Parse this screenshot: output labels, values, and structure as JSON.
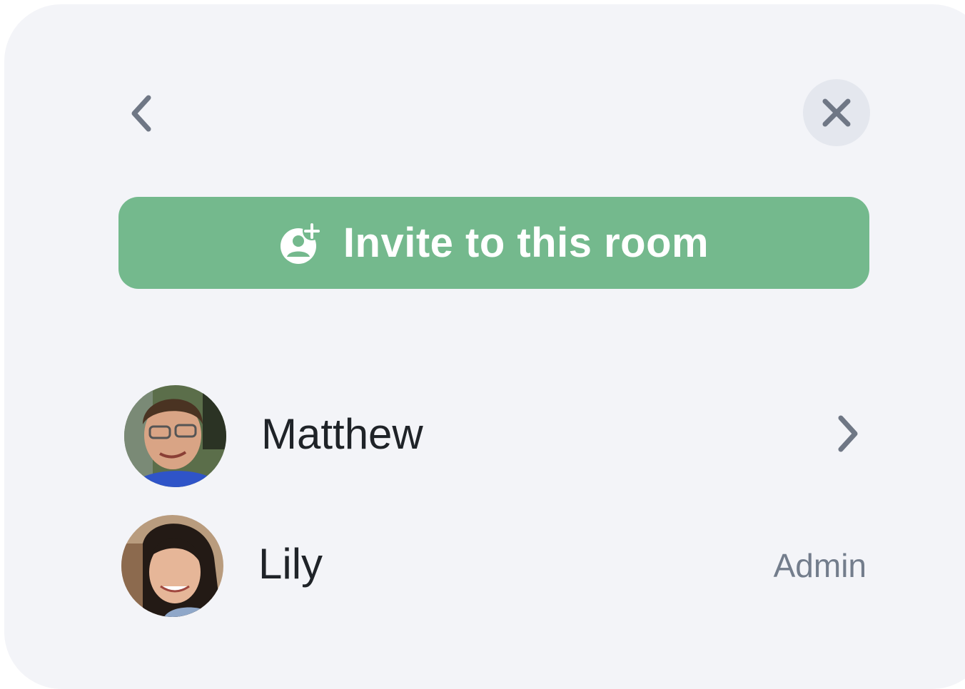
{
  "header": {
    "back_icon": "chevron-left-icon",
    "close_icon": "close-icon"
  },
  "invite": {
    "label": "Invite to this room",
    "icon": "user-add-icon",
    "color": "#74b98d"
  },
  "members": [
    {
      "name": "Matthew",
      "role": "",
      "action_icon": "chevron-right-icon"
    },
    {
      "name": "Lily",
      "role": "Admin"
    }
  ],
  "colors": {
    "panel_bg": "#f3f4f8",
    "icon_gray": "#6f7785",
    "close_bg": "#e4e7ee"
  }
}
